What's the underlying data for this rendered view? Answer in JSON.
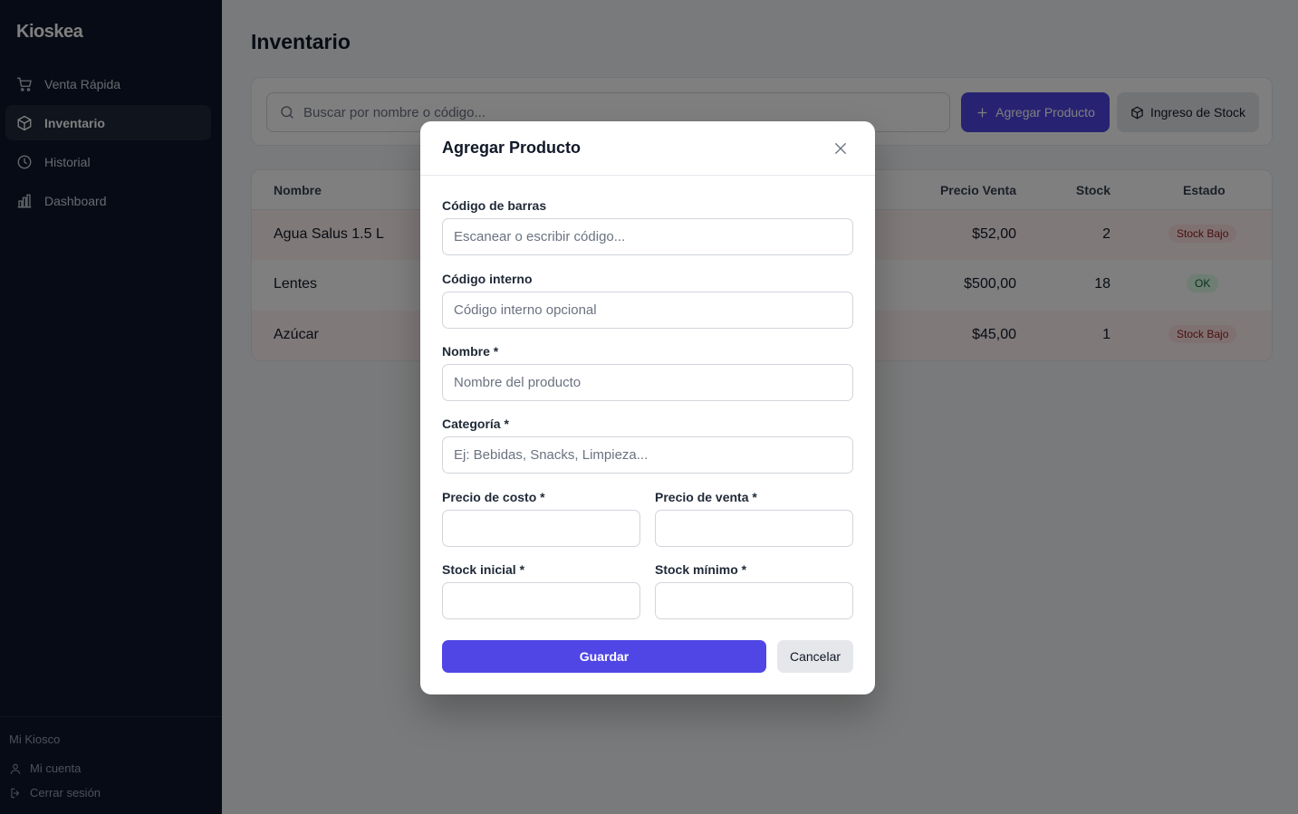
{
  "app": {
    "brand": "Kioskea"
  },
  "sidebar": {
    "items": [
      {
        "label": "Venta Rápida",
        "icon": "cart-icon"
      },
      {
        "label": "Inventario",
        "icon": "box-icon",
        "active": true
      },
      {
        "label": "Historial",
        "icon": "clock-icon"
      },
      {
        "label": "Dashboard",
        "icon": "bar-chart-icon"
      }
    ],
    "store_name": "Mi Kiosco",
    "account_label": "Mi cuenta",
    "logout_label": "Cerrar sesión"
  },
  "main": {
    "title": "Inventario",
    "search": {
      "placeholder": "Buscar por nombre o código...",
      "value": ""
    },
    "add_button": "Agregar Producto",
    "stock_button": "Ingreso de Stock"
  },
  "table": {
    "headers": {
      "name": "Nombre",
      "price": "Precio Venta",
      "stock": "Stock",
      "status": "Estado"
    },
    "rows": [
      {
        "name": "Agua Salus 1.5 L",
        "price": "$52,00",
        "stock": "2",
        "status": "Stock Bajo",
        "status_type": "low"
      },
      {
        "name": "Lentes",
        "price": "$500,00",
        "stock": "18",
        "status": "OK",
        "status_type": "ok"
      },
      {
        "name": "Azúcar",
        "price": "$45,00",
        "stock": "1",
        "status": "Stock Bajo",
        "status_type": "low"
      }
    ]
  },
  "modal": {
    "title": "Agregar Producto",
    "fields": {
      "barcode": {
        "label": "Código de barras",
        "placeholder": "Escanear o escribir código...",
        "value": ""
      },
      "internal_code": {
        "label": "Código interno",
        "placeholder": "Código interno opcional",
        "value": ""
      },
      "name": {
        "label": "Nombre *",
        "placeholder": "Nombre del producto",
        "value": ""
      },
      "category": {
        "label": "Categoría *",
        "placeholder": "Ej: Bebidas, Snacks, Limpieza...",
        "value": ""
      },
      "cost_price": {
        "label": "Precio de costo *",
        "placeholder": "",
        "value": ""
      },
      "sale_price": {
        "label": "Precio de venta *",
        "placeholder": "",
        "value": ""
      },
      "initial_stock": {
        "label": "Stock inicial *",
        "placeholder": "",
        "value": ""
      },
      "min_stock": {
        "label": "Stock mínimo *",
        "placeholder": "",
        "value": ""
      }
    },
    "save_label": "Guardar",
    "cancel_label": "Cancelar"
  },
  "colors": {
    "sidebar_bg": "#0f172a",
    "accent": "#4f46e5",
    "badge_low": "#fee2e2",
    "badge_ok": "#dcfce7"
  }
}
